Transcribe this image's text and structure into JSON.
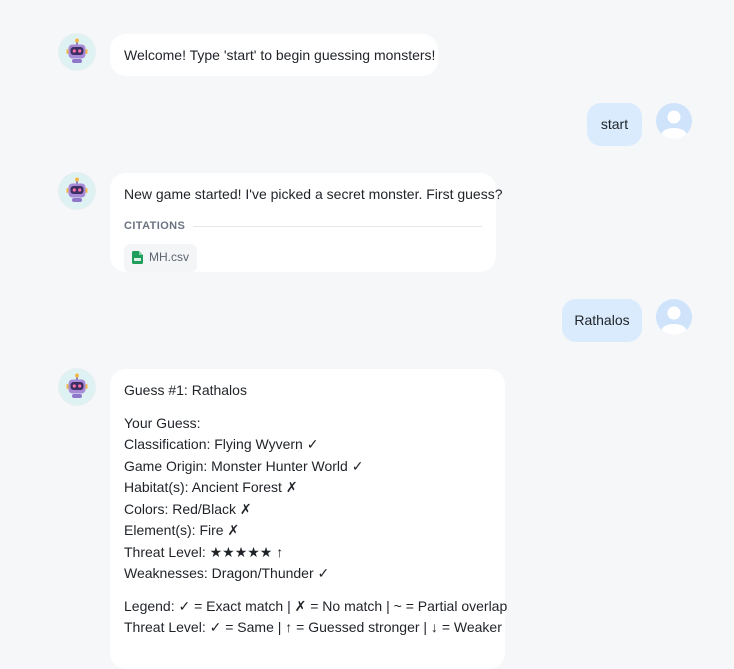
{
  "messages": {
    "m1": {
      "role": "bot",
      "text": "Welcome! Type 'start' to begin guessing monsters!"
    },
    "m2": {
      "role": "user",
      "text": "start"
    },
    "m3": {
      "role": "bot",
      "text": "New game started! I've picked a secret monster. First guess?",
      "citations_label": "CITATIONS",
      "citation_file": "MH.csv"
    },
    "m4": {
      "role": "user",
      "text": "Rathalos"
    },
    "m5": {
      "role": "bot",
      "title": "Guess #1: Rathalos",
      "guess_header": "Your Guess:",
      "attributes": [
        "Classification: Flying Wyvern ✓",
        "Game Origin: Monster Hunter World ✓",
        "Habitat(s): Ancient Forest ✗",
        "Colors: Red/Black ✗",
        "Element(s): Fire ✗",
        "Threat Level: ★★★★★ ↑",
        "Weaknesses: Dragon/Thunder ✓"
      ],
      "legend": [
        "Legend: ✓ = Exact match | ✗ = No match | ~ = Partial overlap",
        "Threat Level: ✓ = Same | ↑ = Guessed stronger | ↓ = Weaker"
      ]
    }
  },
  "icons": {
    "bot_avatar": "robot-icon",
    "user_avatar": "user-icon",
    "citation_file_icon": "csv-file-icon"
  },
  "colors": {
    "background": "#f6f7f9",
    "bot_bubble": "#ffffff",
    "user_bubble": "#d9ebfd",
    "bot_avatar_bg": "#dff2f3",
    "user_avatar_bg": "#cfe4fb",
    "csv_icon": "#1e9e5a"
  }
}
